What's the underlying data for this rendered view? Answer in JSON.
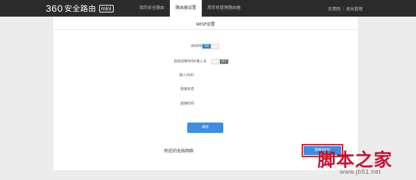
{
  "header": {
    "logo_number": "360",
    "logo_text": "安全路由",
    "logo_badge": "mini",
    "nav": [
      {
        "label": "我的安全路由",
        "active": false
      },
      {
        "label": "路由器设置",
        "active": true
      },
      {
        "label": "用手机管理路由器",
        "active": false
      }
    ],
    "links": [
      "反馈网",
      "退出管理"
    ],
    "link_separator": "|"
  },
  "panel": {
    "title": "WISP设置",
    "rows": {
      "wisp_label": "WISP网络",
      "wisp_toggle": "ON",
      "auto_label": "自动切换WISP接入点",
      "auto_toggle": "OFF",
      "ssid_label": "接入SSID",
      "status_label": "连接状态",
      "time_label": "连接时间"
    },
    "save_label": "保存",
    "nearby_label": "附近的无线网络",
    "search_label": "搜索WISP"
  },
  "watermark": {
    "cn": [
      "脚",
      "本",
      "之",
      "家"
    ],
    "url": "www.jb51.net"
  },
  "colors": {
    "topbar": "#2b2b2b",
    "accent": "#3b8ee3",
    "highlight_border": "#e02020",
    "watermark": "#c8102e"
  }
}
